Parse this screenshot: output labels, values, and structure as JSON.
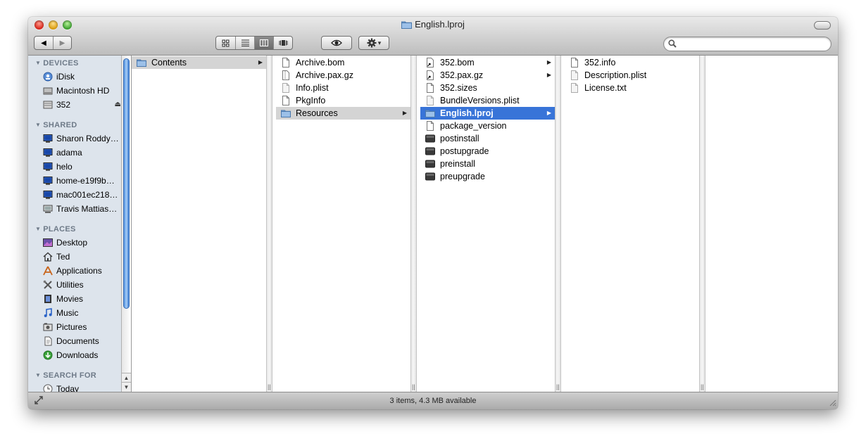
{
  "window": {
    "title": "English.lproj"
  },
  "toolbar": {
    "back": "◀",
    "forward": "▶",
    "views": [
      "icon-view",
      "list-view",
      "column-view",
      "coverflow-view"
    ],
    "active_view": "column-view",
    "gear_caret": "▾",
    "search_placeholder": ""
  },
  "sidebar": {
    "sections": [
      {
        "header": "DEVICES",
        "items": [
          {
            "label": "iDisk",
            "icon": "idisk-icon"
          },
          {
            "label": "Macintosh HD",
            "icon": "harddisk-icon"
          },
          {
            "label": "352",
            "icon": "disk-image-icon",
            "eject": "⏏"
          }
        ]
      },
      {
        "header": "SHARED",
        "items": [
          {
            "label": "Sharon Roddy…",
            "icon": "computer-icon"
          },
          {
            "label": "adama",
            "icon": "computer-icon"
          },
          {
            "label": "helo",
            "icon": "computer-icon"
          },
          {
            "label": "home-e19f9b…",
            "icon": "computer-icon"
          },
          {
            "label": "mac001ec218…",
            "icon": "computer-icon"
          },
          {
            "label": "Travis Mattias…",
            "icon": "network-icon"
          }
        ]
      },
      {
        "header": "PLACES",
        "items": [
          {
            "label": "Desktop",
            "icon": "desktop-icon"
          },
          {
            "label": "Ted",
            "icon": "home-icon"
          },
          {
            "label": "Applications",
            "icon": "applications-icon"
          },
          {
            "label": "Utilities",
            "icon": "utilities-icon"
          },
          {
            "label": "Movies",
            "icon": "movies-icon"
          },
          {
            "label": "Music",
            "icon": "music-icon"
          },
          {
            "label": "Pictures",
            "icon": "pictures-icon"
          },
          {
            "label": "Documents",
            "icon": "documents-icon"
          },
          {
            "label": "Downloads",
            "icon": "downloads-icon"
          }
        ]
      },
      {
        "header": "SEARCH FOR",
        "items": [
          {
            "label": "Today",
            "icon": "clock-icon"
          }
        ]
      }
    ]
  },
  "columns": [
    {
      "items": [
        {
          "label": "Contents",
          "type": "folder",
          "arrow": true,
          "selected": "gray"
        }
      ]
    },
    {
      "items": [
        {
          "label": "Archive.bom",
          "type": "file"
        },
        {
          "label": "Archive.pax.gz",
          "type": "archive"
        },
        {
          "label": "Info.plist",
          "type": "plist"
        },
        {
          "label": "PkgInfo",
          "type": "file"
        },
        {
          "label": "Resources",
          "type": "folder",
          "arrow": true,
          "selected": "gray"
        }
      ]
    },
    {
      "items": [
        {
          "label": "352.bom",
          "type": "alias",
          "arrow": true
        },
        {
          "label": "352.pax.gz",
          "type": "alias",
          "arrow": true
        },
        {
          "label": "352.sizes",
          "type": "file"
        },
        {
          "label": "BundleVersions.plist",
          "type": "plist"
        },
        {
          "label": "English.lproj",
          "type": "folder",
          "arrow": true,
          "selected": "blue"
        },
        {
          "label": "package_version",
          "type": "file"
        },
        {
          "label": "postinstall",
          "type": "exec"
        },
        {
          "label": "postupgrade",
          "type": "exec"
        },
        {
          "label": "preinstall",
          "type": "exec"
        },
        {
          "label": "preupgrade",
          "type": "exec"
        }
      ]
    },
    {
      "items": [
        {
          "label": "352.info",
          "type": "file"
        },
        {
          "label": "Description.plist",
          "type": "plist"
        },
        {
          "label": "License.txt",
          "type": "plist"
        }
      ]
    },
    {
      "items": []
    }
  ],
  "status": {
    "text": "3 items, 4.3 MB available"
  }
}
